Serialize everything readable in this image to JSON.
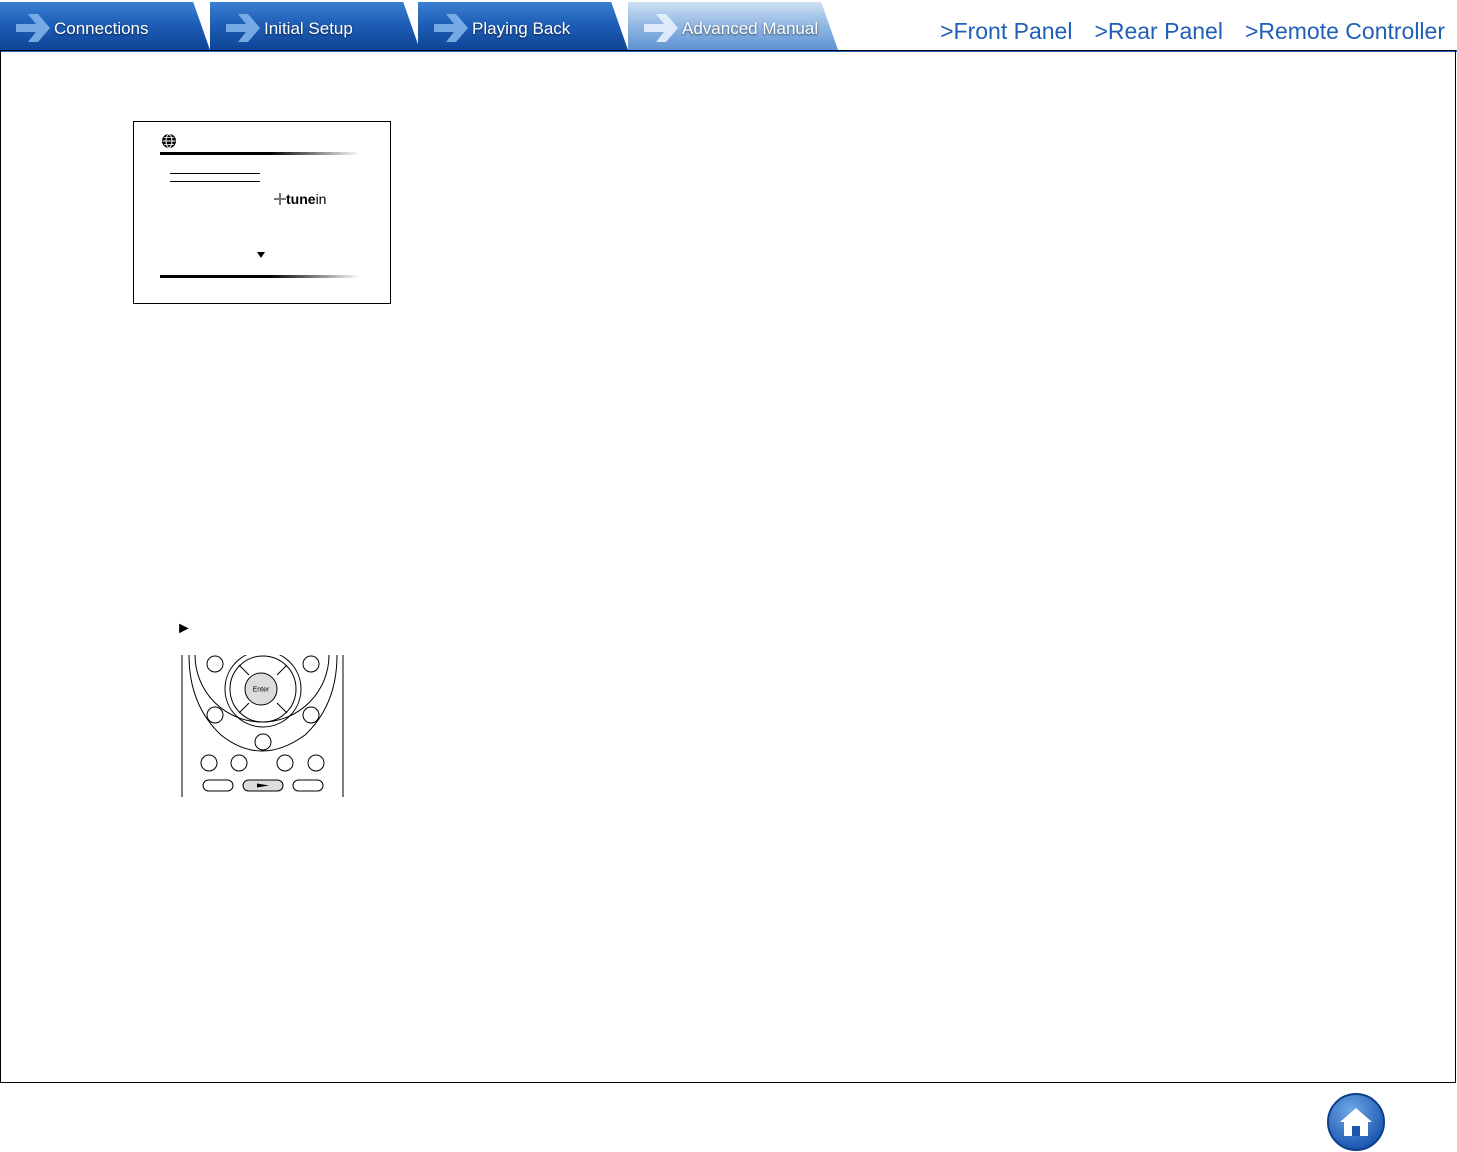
{
  "tabs": [
    {
      "label": "Connections"
    },
    {
      "label": "Initial Setup"
    },
    {
      "label": "Playing Back"
    },
    {
      "label": "Advanced Manual"
    }
  ],
  "top_links": [
    {
      "label": ">Front Panel"
    },
    {
      "label": ">Rear Panel"
    },
    {
      "label": ">Remote Controller"
    }
  ],
  "screen": {
    "logo_strong": "tune",
    "logo_rest": "in"
  },
  "remote": {
    "enter_label": "Enter",
    "play_symbol": "►"
  },
  "colors": {
    "accent": "#1f5fb8",
    "tab_active": "#8fb6e2"
  },
  "icons": {
    "tab_arrow": "arrow-right-icon",
    "home": "home-icon",
    "globe": "globe-icon"
  }
}
